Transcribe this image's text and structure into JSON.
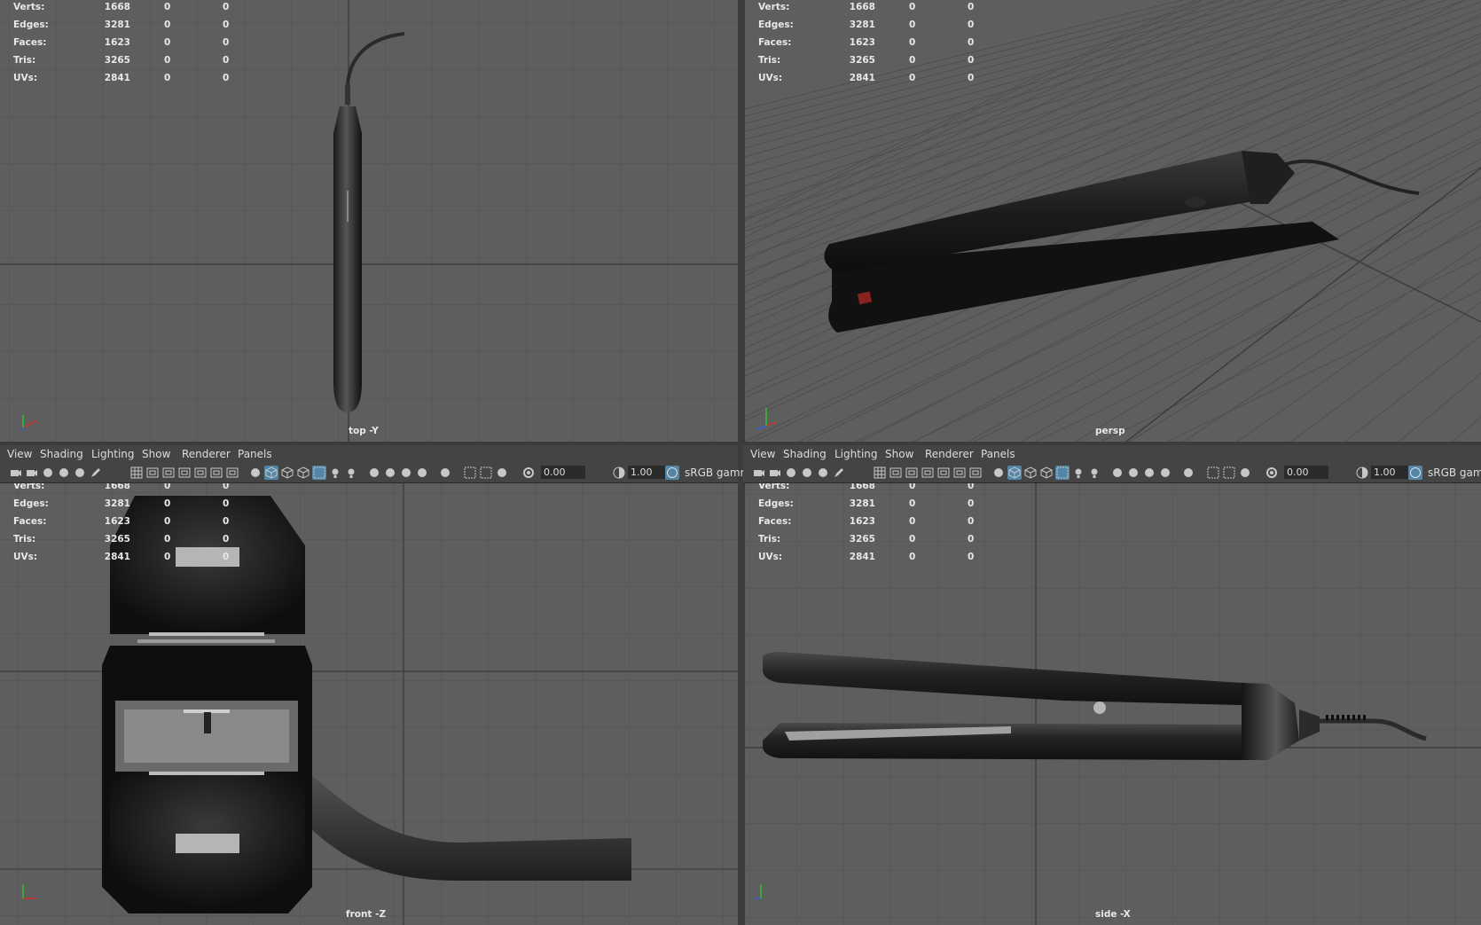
{
  "stats": {
    "rows": [
      {
        "label": "Verts:",
        "v1": "1668",
        "v2": "0",
        "v3": "0"
      },
      {
        "label": "Edges:",
        "v1": "3281",
        "v2": "0",
        "v3": "0"
      },
      {
        "label": "Faces:",
        "v1": "1623",
        "v2": "0",
        "v3": "0"
      },
      {
        "label": "Tris:",
        "v1": "3265",
        "v2": "0",
        "v3": "0"
      },
      {
        "label": "UVs:",
        "v1": "2841",
        "v2": "0",
        "v3": "0"
      }
    ]
  },
  "viewports": {
    "top": {
      "label": "top -Y"
    },
    "persp": {
      "label": "persp"
    },
    "front": {
      "label": "front -Z"
    },
    "side": {
      "label": "side -X"
    }
  },
  "menu": {
    "items": [
      "View",
      "Shading",
      "Lighting",
      "Show",
      "Renderer",
      "Panels"
    ]
  },
  "toolbar": {
    "exposure": "0.00",
    "gamma_value": "1.00",
    "color_space": "sRGB gamm"
  },
  "axis": {
    "x": "x",
    "y": "y",
    "z": "z"
  },
  "colors": {
    "viewport_bg": "#5e5e5e",
    "grid": "#525252",
    "accent": "#5285a6",
    "ui_bg": "#444444"
  }
}
